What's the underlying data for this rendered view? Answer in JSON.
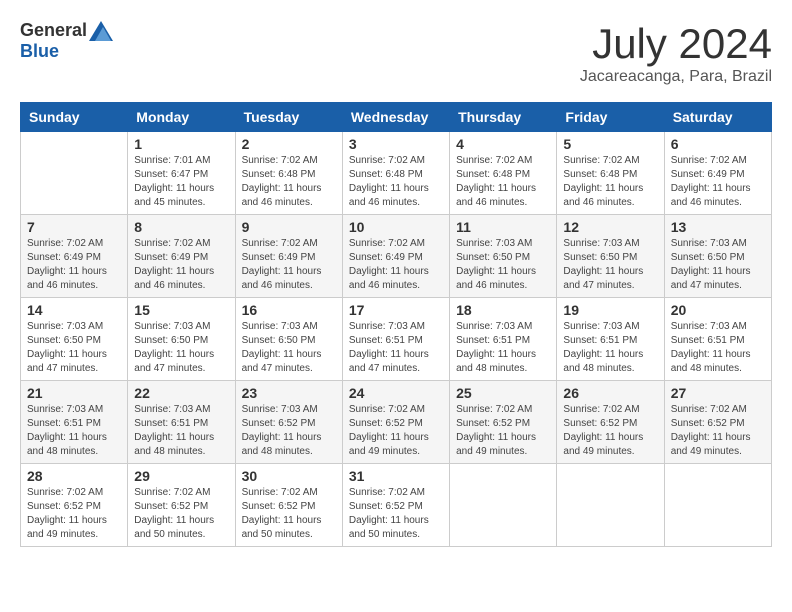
{
  "header": {
    "logo_general": "General",
    "logo_blue": "Blue",
    "month_year": "July 2024",
    "location": "Jacareacanga, Para, Brazil"
  },
  "days_of_week": [
    "Sunday",
    "Monday",
    "Tuesday",
    "Wednesday",
    "Thursday",
    "Friday",
    "Saturday"
  ],
  "weeks": [
    [
      {
        "day": "",
        "info": ""
      },
      {
        "day": "1",
        "info": "Sunrise: 7:01 AM\nSunset: 6:47 PM\nDaylight: 11 hours\nand 45 minutes."
      },
      {
        "day": "2",
        "info": "Sunrise: 7:02 AM\nSunset: 6:48 PM\nDaylight: 11 hours\nand 46 minutes."
      },
      {
        "day": "3",
        "info": "Sunrise: 7:02 AM\nSunset: 6:48 PM\nDaylight: 11 hours\nand 46 minutes."
      },
      {
        "day": "4",
        "info": "Sunrise: 7:02 AM\nSunset: 6:48 PM\nDaylight: 11 hours\nand 46 minutes."
      },
      {
        "day": "5",
        "info": "Sunrise: 7:02 AM\nSunset: 6:48 PM\nDaylight: 11 hours\nand 46 minutes."
      },
      {
        "day": "6",
        "info": "Sunrise: 7:02 AM\nSunset: 6:49 PM\nDaylight: 11 hours\nand 46 minutes."
      }
    ],
    [
      {
        "day": "7",
        "info": "Sunrise: 7:02 AM\nSunset: 6:49 PM\nDaylight: 11 hours\nand 46 minutes."
      },
      {
        "day": "8",
        "info": "Sunrise: 7:02 AM\nSunset: 6:49 PM\nDaylight: 11 hours\nand 46 minutes."
      },
      {
        "day": "9",
        "info": "Sunrise: 7:02 AM\nSunset: 6:49 PM\nDaylight: 11 hours\nand 46 minutes."
      },
      {
        "day": "10",
        "info": "Sunrise: 7:02 AM\nSunset: 6:49 PM\nDaylight: 11 hours\nand 46 minutes."
      },
      {
        "day": "11",
        "info": "Sunrise: 7:03 AM\nSunset: 6:50 PM\nDaylight: 11 hours\nand 46 minutes."
      },
      {
        "day": "12",
        "info": "Sunrise: 7:03 AM\nSunset: 6:50 PM\nDaylight: 11 hours\nand 47 minutes."
      },
      {
        "day": "13",
        "info": "Sunrise: 7:03 AM\nSunset: 6:50 PM\nDaylight: 11 hours\nand 47 minutes."
      }
    ],
    [
      {
        "day": "14",
        "info": "Sunrise: 7:03 AM\nSunset: 6:50 PM\nDaylight: 11 hours\nand 47 minutes."
      },
      {
        "day": "15",
        "info": "Sunrise: 7:03 AM\nSunset: 6:50 PM\nDaylight: 11 hours\nand 47 minutes."
      },
      {
        "day": "16",
        "info": "Sunrise: 7:03 AM\nSunset: 6:50 PM\nDaylight: 11 hours\nand 47 minutes."
      },
      {
        "day": "17",
        "info": "Sunrise: 7:03 AM\nSunset: 6:51 PM\nDaylight: 11 hours\nand 47 minutes."
      },
      {
        "day": "18",
        "info": "Sunrise: 7:03 AM\nSunset: 6:51 PM\nDaylight: 11 hours\nand 48 minutes."
      },
      {
        "day": "19",
        "info": "Sunrise: 7:03 AM\nSunset: 6:51 PM\nDaylight: 11 hours\nand 48 minutes."
      },
      {
        "day": "20",
        "info": "Sunrise: 7:03 AM\nSunset: 6:51 PM\nDaylight: 11 hours\nand 48 minutes."
      }
    ],
    [
      {
        "day": "21",
        "info": "Sunrise: 7:03 AM\nSunset: 6:51 PM\nDaylight: 11 hours\nand 48 minutes."
      },
      {
        "day": "22",
        "info": "Sunrise: 7:03 AM\nSunset: 6:51 PM\nDaylight: 11 hours\nand 48 minutes."
      },
      {
        "day": "23",
        "info": "Sunrise: 7:03 AM\nSunset: 6:52 PM\nDaylight: 11 hours\nand 48 minutes."
      },
      {
        "day": "24",
        "info": "Sunrise: 7:02 AM\nSunset: 6:52 PM\nDaylight: 11 hours\nand 49 minutes."
      },
      {
        "day": "25",
        "info": "Sunrise: 7:02 AM\nSunset: 6:52 PM\nDaylight: 11 hours\nand 49 minutes."
      },
      {
        "day": "26",
        "info": "Sunrise: 7:02 AM\nSunset: 6:52 PM\nDaylight: 11 hours\nand 49 minutes."
      },
      {
        "day": "27",
        "info": "Sunrise: 7:02 AM\nSunset: 6:52 PM\nDaylight: 11 hours\nand 49 minutes."
      }
    ],
    [
      {
        "day": "28",
        "info": "Sunrise: 7:02 AM\nSunset: 6:52 PM\nDaylight: 11 hours\nand 49 minutes."
      },
      {
        "day": "29",
        "info": "Sunrise: 7:02 AM\nSunset: 6:52 PM\nDaylight: 11 hours\nand 50 minutes."
      },
      {
        "day": "30",
        "info": "Sunrise: 7:02 AM\nSunset: 6:52 PM\nDaylight: 11 hours\nand 50 minutes."
      },
      {
        "day": "31",
        "info": "Sunrise: 7:02 AM\nSunset: 6:52 PM\nDaylight: 11 hours\nand 50 minutes."
      },
      {
        "day": "",
        "info": ""
      },
      {
        "day": "",
        "info": ""
      },
      {
        "day": "",
        "info": ""
      }
    ]
  ]
}
